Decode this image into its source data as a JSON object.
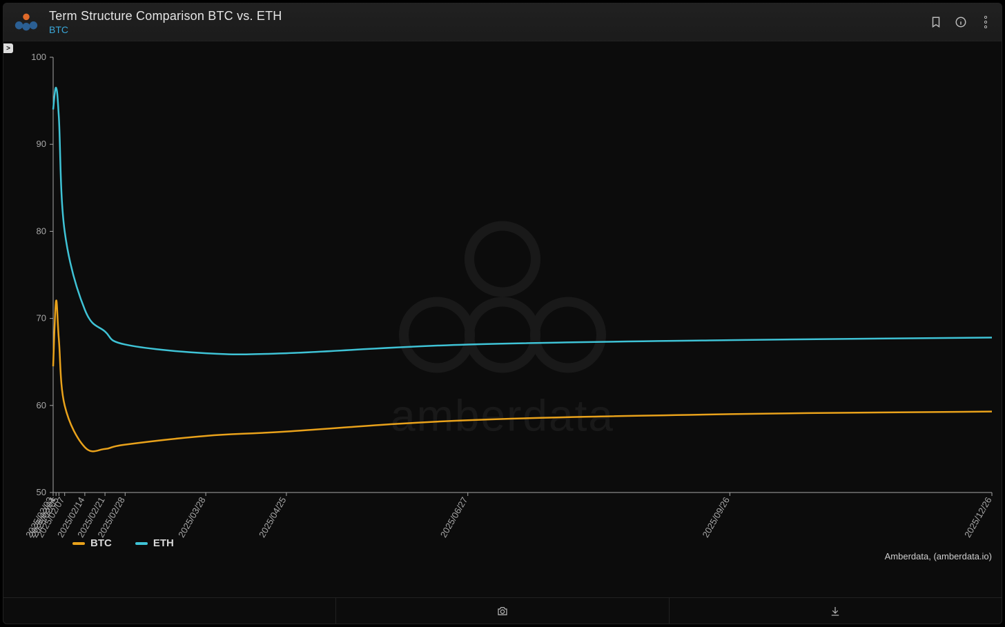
{
  "header": {
    "title": "Term Structure Comparison BTC vs. ETH",
    "subtitle": "BTC"
  },
  "legend": {
    "btc": "BTC",
    "eth": "ETH"
  },
  "attribution": "Amberdata, (amberdata.io)",
  "watermark_text": "amberdata",
  "colors": {
    "btc": "#e9a21b",
    "eth": "#3fc3d6"
  },
  "chart_data": {
    "type": "line",
    "title": "Term Structure Comparison BTC vs. ETH",
    "xlabel": "",
    "ylabel": "",
    "ylim": [
      50,
      100
    ],
    "y_ticks": [
      50,
      60,
      70,
      80,
      90,
      100
    ],
    "x_categories": [
      "2025/02/03",
      "2025/02/04",
      "2025/02/05",
      "2025/02/07",
      "2025/02/14",
      "2025/02/21",
      "2025/02/28",
      "2025/03/28",
      "2025/04/25",
      "2025/06/27",
      "2025/09/26",
      "2025/12/26"
    ],
    "x_tick_labels": [
      "2025/02/03",
      "2025/02/04",
      "2025/02/05",
      "2025/02/07",
      "2025/02/14",
      "2025/02/21",
      "2025/02/28",
      "2025/03/28",
      "2025/04/25",
      "2025/06/27",
      "2025/09/26",
      "2025/12/26"
    ],
    "series": [
      {
        "name": "BTC",
        "color": "#e9a21b",
        "values": [
          64.5,
          72.0,
          67.5,
          60.0,
          55.2,
          55.0,
          55.5,
          56.5,
          57.0,
          58.3,
          59.0,
          59.3
        ]
      },
      {
        "name": "ETH",
        "color": "#3fc3d6",
        "values": [
          94.0,
          96.5,
          93.0,
          80.0,
          71.0,
          68.5,
          67.0,
          66.0,
          66.0,
          67.0,
          67.5,
          67.8
        ]
      }
    ]
  }
}
